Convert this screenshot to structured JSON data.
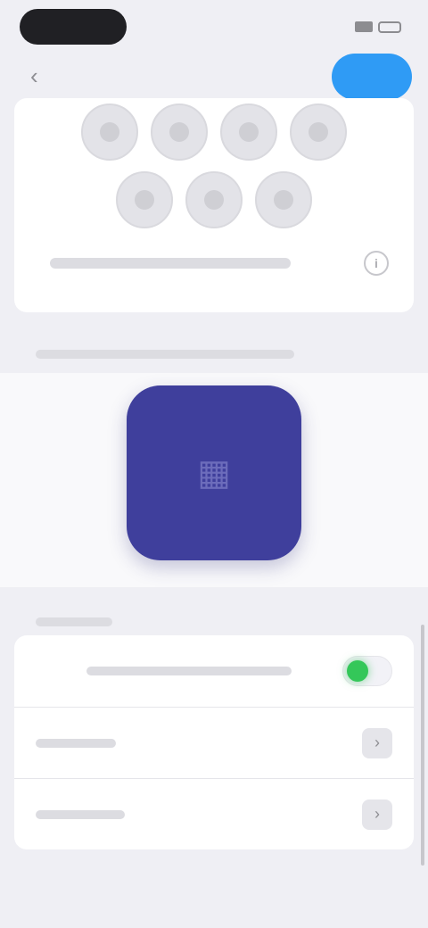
{
  "nav": {
    "back_icon": "chevron-left-icon",
    "title": "",
    "done_label": ""
  },
  "avatars": {
    "row1": [
      "person-icon",
      "person-icon",
      "person-icon",
      "person-icon"
    ],
    "row2": [
      "person-icon",
      "person-icon",
      "person-icon"
    ],
    "info_icon": "info-icon",
    "caption": ""
  },
  "picture_section": {
    "label": "",
    "preview_color": "#3f3f9c"
  },
  "options_section": {
    "label": "",
    "rows": [
      {
        "label": "",
        "control": "toggle",
        "toggle_color": "#34c759"
      },
      {
        "label": "",
        "control": "disclosure"
      },
      {
        "label": "",
        "control": "disclosure"
      }
    ]
  },
  "colors": {
    "background": "#efeff4",
    "accent": "#2f9bf5",
    "tile": "#3f3f9c",
    "toggle_on": "#34c759"
  }
}
